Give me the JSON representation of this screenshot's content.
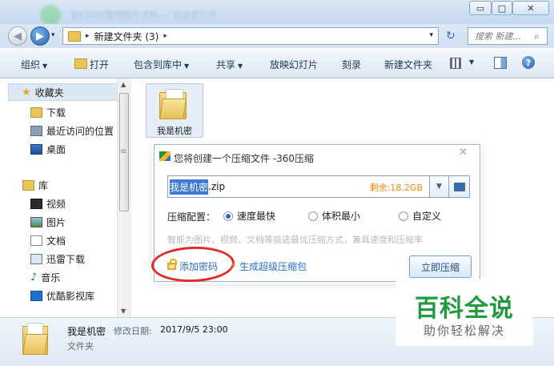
{
  "window": {
    "blurred_title": "我们如何整理照片资料 — 在这里打开",
    "minimize_glyph": "▭",
    "maximize_glyph": "□",
    "close_glyph": "✕"
  },
  "address_bar": {
    "back_glyph": "◀",
    "forward_glyph": "▶",
    "dropdown_glyph": "▾",
    "separator_glyph": "▸",
    "path": "新建文件夹 (3)",
    "refresh_glyph": "↻",
    "search_placeholder": "搜索 新建...",
    "search_glyph": "⌕"
  },
  "toolbar": {
    "organize": "组织",
    "open": "打开",
    "include_in_library": "包含到库中",
    "share": "共享",
    "slideshow": "放映幻灯片",
    "burn": "刻录",
    "new_folder": "新建文件夹",
    "caret": "▼",
    "help_glyph": "?"
  },
  "nav_pane": {
    "favorites": "收藏夹",
    "downloads": "下载",
    "recent": "最近访问的位置",
    "desktop": "桌面",
    "libraries": "库",
    "videos": "视频",
    "pictures": "图片",
    "documents": "文档",
    "xunlei": "迅雷下载",
    "music": "音乐",
    "youku": "优酷影视库",
    "star_glyph": "★",
    "music_glyph": "♪",
    "scroll_up": "▲",
    "scroll_down": "▼",
    "grip": "≡"
  },
  "content": {
    "file_name": "我是机密"
  },
  "dialog": {
    "title": "您将创建一个压缩文件 -360压缩",
    "close_glyph": "✕",
    "name_selected": "我是机密",
    "name_ext": ".zip",
    "remaining_space": "剩余:18.2GB",
    "dropdown_glyph": "▼",
    "config_label": "压缩配置：",
    "options": [
      "速度最快",
      "体积最小",
      "自定义"
    ],
    "selected_option_index": 0,
    "hint": "智能为图片、视频、文档等挑选最优压缩方式，兼具速度和压缩率",
    "add_password": "添加密码",
    "sfx": "生成超级压缩包",
    "bolt_glyph": "⚡",
    "compress_button": "立即压缩"
  },
  "status_bar": {
    "name": "我是机密",
    "date_label": "修改日期:",
    "date": "2017/9/5 23:00",
    "type": "文件夹"
  },
  "watermark": {
    "title": "百科全说",
    "subtitle": "助你轻松解决"
  }
}
